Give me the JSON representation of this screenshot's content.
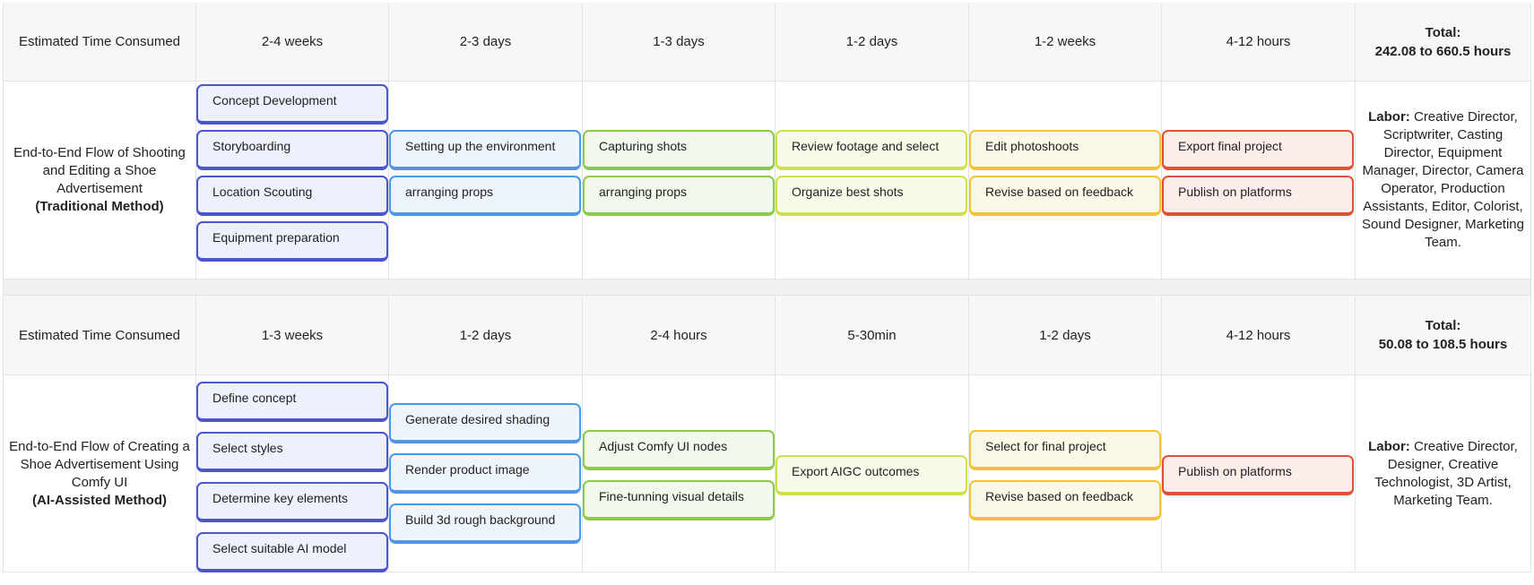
{
  "traditional": {
    "time_label": "Estimated Time Consumed",
    "durations": [
      "2-4 weeks",
      "2-3 days",
      "1-3 days",
      "1-2 days",
      "1-2 weeks",
      "4-12 hours"
    ],
    "total_label": "Total:",
    "total_value": "242.08 to 660.5 hours",
    "flow_title": "End-to-End Flow of Shooting and Editing a Shoe Advertisement",
    "flow_method": "(Traditional Method)",
    "stages": [
      [
        "Concept Development",
        "Storyboarding",
        "Location Scouting",
        "Equipment preparation"
      ],
      [
        "Setting up the environment",
        "arranging props"
      ],
      [
        "Capturing shots",
        "arranging props"
      ],
      [
        "Review footage and select",
        "Organize best shots"
      ],
      [
        "Edit photoshoots",
        "Revise based on feedback"
      ],
      [
        "Export final project",
        "Publish on platforms"
      ]
    ],
    "labor_label": "Labor:",
    "labor_text": "Creative Director, Scriptwriter, Casting Director, Equipment Manager, Director, Camera Operator, Production Assistants, Editor, Colorist, Sound Designer, Marketing Team."
  },
  "ai": {
    "time_label": "Estimated Time Consumed",
    "durations": [
      "1-3 weeks",
      "1-2 days",
      "2-4 hours",
      "5-30min",
      "1-2 days",
      "4-12 hours"
    ],
    "total_label": "Total:",
    "total_value": "50.08 to 108.5 hours",
    "flow_title": "End-to-End Flow of Creating a Shoe Advertisement Using Comfy UI",
    "flow_method": "(AI-Assisted Method)",
    "stages": [
      [
        "Define concept",
        "Select styles",
        "Determine key elements",
        "Select suitable AI model"
      ],
      [
        "Generate desired shading",
        "Render product image",
        "Build 3d rough background"
      ],
      [
        "Adjust Comfy UI nodes",
        "Fine-tunning visual details"
      ],
      [
        "Export AIGC outcomes"
      ],
      [
        "Select for final project",
        "Revise based on feedback"
      ],
      [
        "Publish on platforms"
      ]
    ],
    "labor_label": "Labor:",
    "labor_text": "Creative Director, Designer, Creative Technologist, 3D Artist, Marketing Team."
  },
  "colors": {
    "stage1": "#4b55cf",
    "stage2": "#4f97e2",
    "stage3": "#8dc84f",
    "stage4": "#cfe04d",
    "stage5": "#f2c332",
    "stage6": "#e05138"
  }
}
